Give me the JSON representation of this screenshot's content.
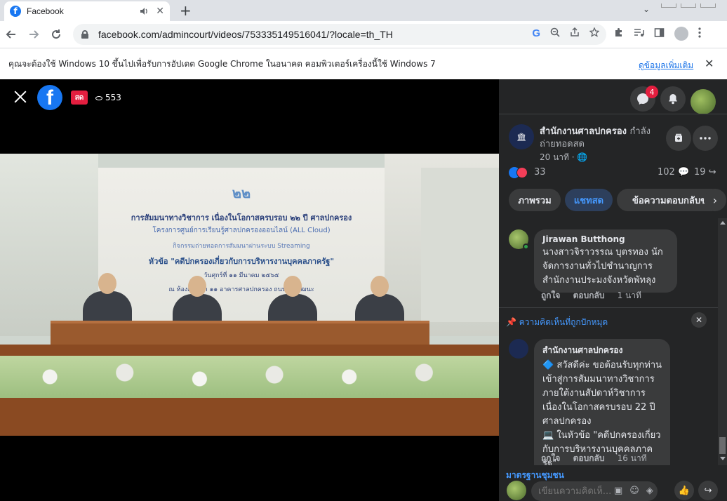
{
  "browser": {
    "tab_title": "Facebook",
    "tab_close": "✕",
    "new_tab": "+",
    "tab_search": "⌄",
    "url": "facebook.com/admincourt/videos/753335149516041/?locale=th_TH"
  },
  "infobar": {
    "message": "คุณจะต้องใช้ Windows 10 ขึ้นไปเพื่อรับการอัปเดต Google Chrome ในอนาคต คอมพิวเตอร์เครื่องนี้ใช้ Windows 7",
    "link": "ดูข้อมูลเพิ่มเติม",
    "close": "✕"
  },
  "video": {
    "live_label": "สด",
    "viewers": "553",
    "backdrop": {
      "logo": "๒๒",
      "line1": "การสัมมนาทางวิชาการ เนื่องในโอกาสครบรอบ ๒๒ ปี ศาลปกครอง",
      "line2": "โครงการศูนย์การเรียนรู้ศาลปกครองออนไลน์ (ALL Cloud)",
      "line3": "กิจกรรมถ่ายทอดการสัมมนาผ่านระบบ Streaming",
      "line4": "หัวข้อ \"คดีปกครองเกี่ยวกับการบริหารงานบุคคลภาครัฐ\"",
      "line5": "วันศุกร์ที่ ๑๑ มีนาคม ๒๕๖๕",
      "line6": "ณ ห้องสัมมนา ๑๑ อาคารศาลปกครอง ถนนแจ้งวัฒนะ"
    }
  },
  "panel": {
    "messenger_badge": "4",
    "page_name": "สำนักงานศาลปกครอง",
    "page_name_suffix": "กำลังถ่ายทอดสด",
    "post_time": "20 นาที · 🌐",
    "reaction_count": "33",
    "comment_count": "102 💬",
    "share_count": "19 ↪",
    "tabs": [
      "ภาพรวม",
      "แชทสด",
      "ข้อความตอบกลับข"
    ],
    "comments": [
      {
        "author": "Jirawan Butthong",
        "body": "นางสาวจิราวรรณ บุตรทอง นักจัดการงานทั่วไปชำนาญการ สำนักงานประมงจังหวัดพัทลุง",
        "like": "ถูกใจ",
        "reply": "ตอบกลับ",
        "time": "1 นาที"
      }
    ],
    "pinned_label": "📌 ความคิดเห็นที่ถูกปักหมุด",
    "pinned": {
      "author": "สำนักงานศาลปกครอง",
      "body1": "🔷 สวัสดีค่ะ ขอต้อนรับทุกท่านเข้าสู่การสัมมนาทางวิชาการ ภายใต้งานสัปดาห์วิชาการ เนื่องในโอกาสครบรอบ 22 ปี ศาลปกครอง",
      "body2": "💻 ในหัวข้อ \"คดีปกครองเกี่ยวกับการบริหารงานบุคคลภาครัฐ\"",
      "like": "ถูกใจ",
      "reply": "ตอบกลับ",
      "time": "16 นาที"
    },
    "community_standards": "มาตรฐานชุมชน",
    "compose_placeholder": "เขียนความคิดเห็...",
    "page_avatar_text": "🏛"
  }
}
